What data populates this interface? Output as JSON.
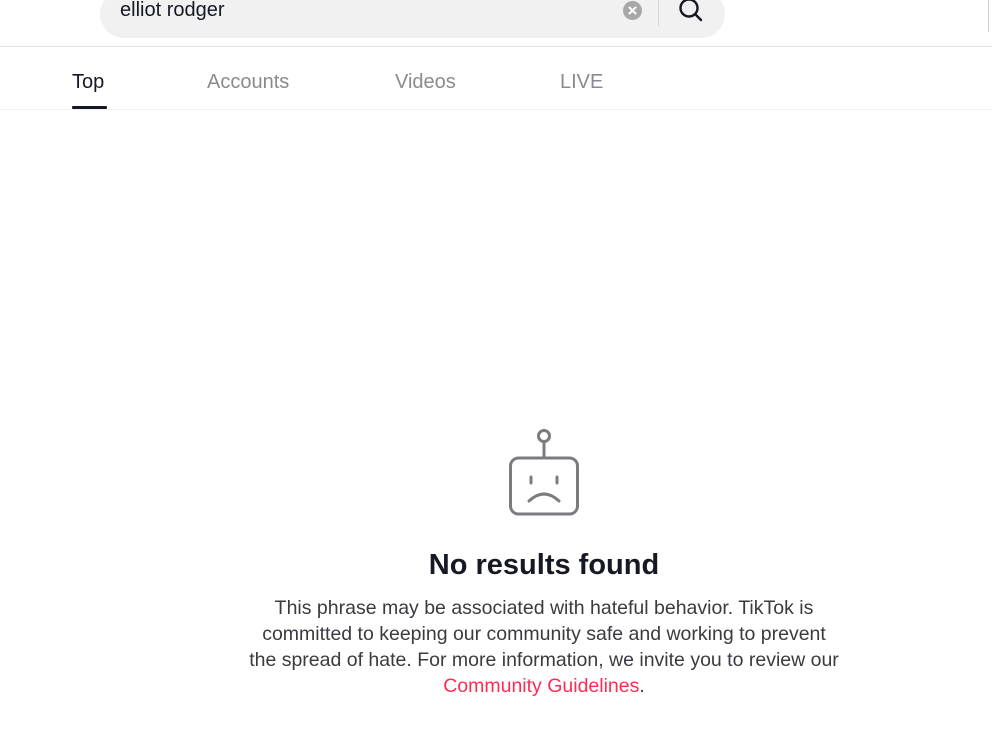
{
  "search": {
    "query": "elliot rodger",
    "clear_icon": "clear-x-circle-icon",
    "search_icon": "magnifier-icon"
  },
  "tabs": [
    {
      "label": "Top",
      "active": true
    },
    {
      "label": "Accounts",
      "active": false
    },
    {
      "label": "Videos",
      "active": false
    },
    {
      "label": "LIVE",
      "active": false
    }
  ],
  "empty_state": {
    "icon": "sad-robot-icon",
    "title": "No results found",
    "description_before_link": "This phrase may be associated with hateful behavior. TikTok is committed to keeping our community safe and working to prevent the spread of hate. For more information, we invite you to review our ",
    "link_text": "Community Guidelines",
    "description_after_link": "."
  },
  "colors": {
    "link": "#fe2c55",
    "text_primary": "#161823",
    "text_muted": "#8a8b91",
    "search_bg": "#f1f1f2"
  }
}
